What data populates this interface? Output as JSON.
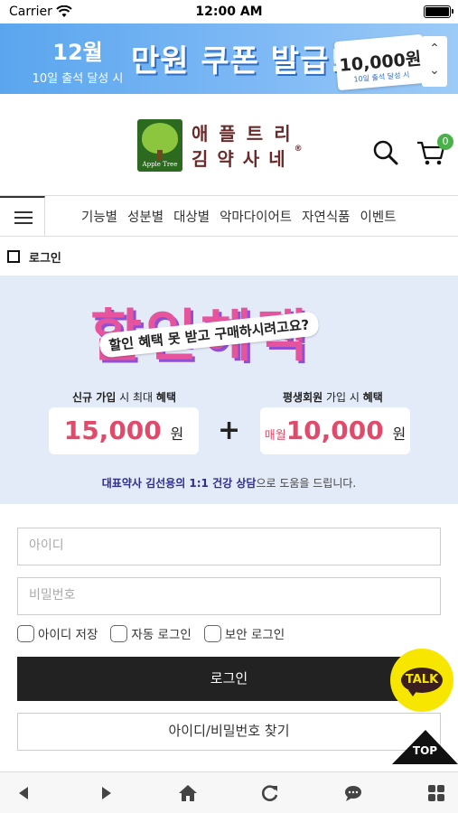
{
  "status_bar": {
    "carrier": "Carrier",
    "time": "12:00 AM"
  },
  "promo_banner": {
    "month": "12월",
    "month_sub": "10일 출석 달성 시",
    "headline": "만원 쿠폰 발급!",
    "coupon_amount": "10,000원",
    "coupon_sub": "10일 출석 달성 시"
  },
  "header": {
    "logo_label": "Apple Tree",
    "logo_line1": "애플트리",
    "logo_line2": "김약사네",
    "logo_reg": "®",
    "cart_count": "0"
  },
  "nav": {
    "items": [
      "기능별",
      "성분별",
      "대상별",
      "악마다이어트",
      "자연식품",
      "이벤트"
    ]
  },
  "breadcrumb": {
    "title": "로그인"
  },
  "benefit_banner": {
    "title": "할인혜택",
    "ribbon": "할인 혜택 못 받고 구매하시려고요?",
    "left_label_pre": "신규 가입",
    "left_label_mid": " 시 최대 ",
    "left_label_post": "혜택",
    "left_value": "15,000",
    "left_unit": "원",
    "plus": "+",
    "right_label_pre": "평생회원",
    "right_label_mid": " 가입 시 ",
    "right_label_post": "혜택",
    "right_prefix": "매월",
    "right_value": "10,000",
    "right_unit": "원",
    "footer_strong": "대표약사 김선용의 1:1 건강 상담",
    "footer_rest": "으로 도움을 드립니다."
  },
  "login_form": {
    "id_placeholder": "아이디",
    "pw_placeholder": "비밀번호",
    "save_id_label": "아이디 저장",
    "auto_login_label": "자동 로그인",
    "secure_login_label": "보안 로그인",
    "login_button": "로그인",
    "find_button": "아이디/비밀번호 찾기"
  },
  "floating": {
    "talk_label": "TALK",
    "top_label": "TOP"
  },
  "colors": {
    "promo_blue": "#6fb0f2",
    "banner_bg": "#e3eaf8",
    "accent_pink": "#e14a6b",
    "cart_badge": "#49b04a",
    "kakao_yellow": "#f7e600",
    "login_button": "#222222"
  }
}
